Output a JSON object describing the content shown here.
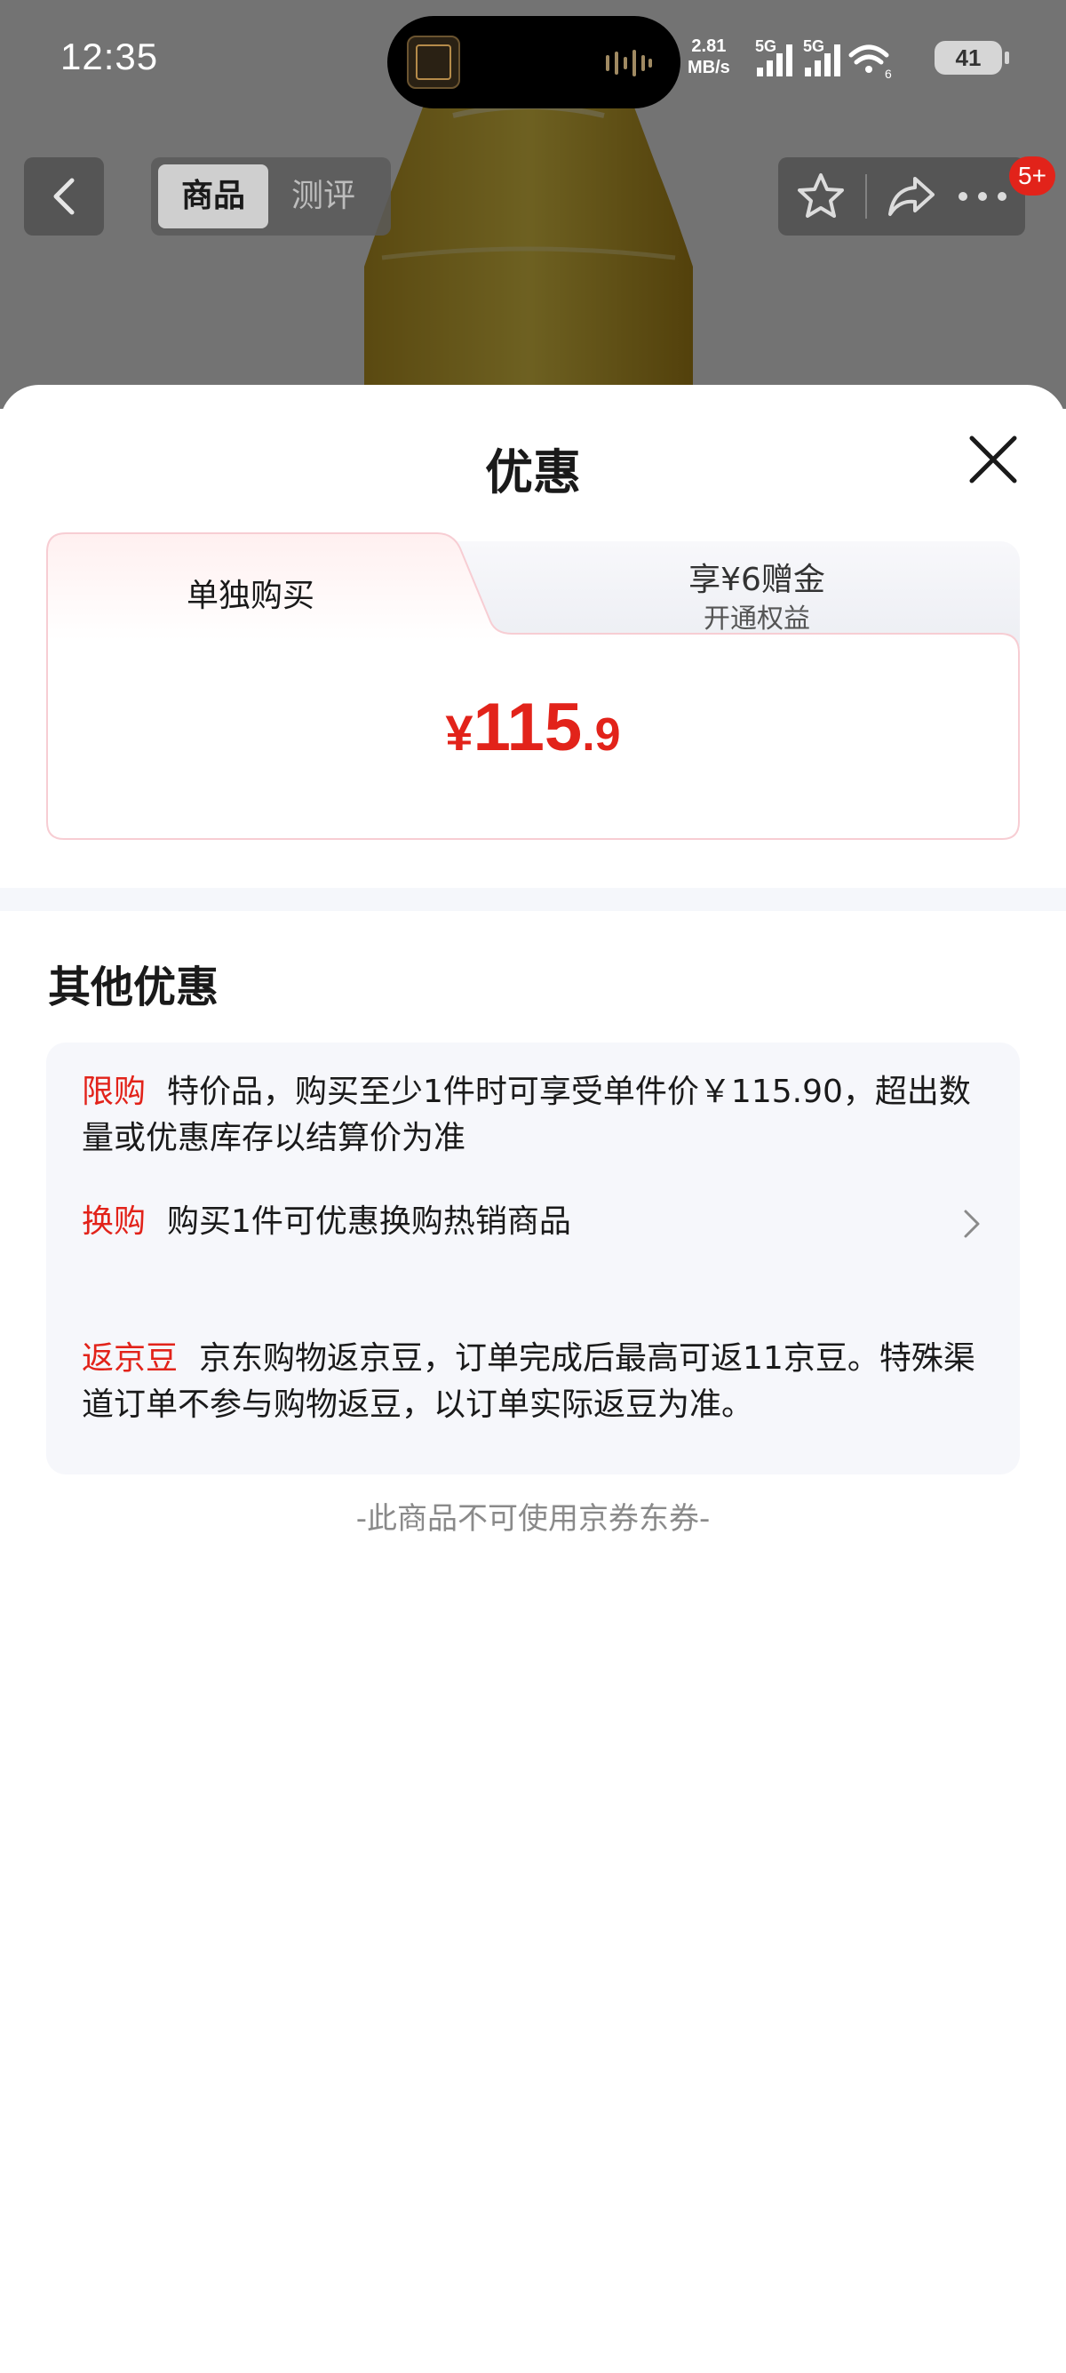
{
  "status_bar": {
    "time": "12:35",
    "net_speed_value": "2.81",
    "net_speed_unit": "MB/s",
    "signal_1_label": "5G",
    "signal_2_label": "5G",
    "wifi_label": "6",
    "battery": "41",
    "icons": [
      "cellular-signal-icon",
      "cellular-signal-icon",
      "wifi-icon",
      "battery-icon"
    ]
  },
  "nav": {
    "tabs": [
      {
        "label": "商品",
        "active": true
      },
      {
        "label": "测评",
        "active": false
      }
    ],
    "badge": "5+",
    "icons": [
      "back-icon",
      "star-icon",
      "share-icon",
      "more-icon"
    ]
  },
  "sheet": {
    "title": "优惠",
    "price_tabs": {
      "tab1_label": "单独购买",
      "tab2_line1": "享¥6赠金",
      "tab2_line2": "开通权益"
    },
    "price": {
      "currency": "¥",
      "integer": "115",
      "decimal": ".9"
    },
    "other_title": "其他优惠",
    "offers": [
      {
        "tag": "限购",
        "text": "特价品，购买至少1件时可享受单件价￥115.90，超出数量或优惠库存以结算价为准"
      },
      {
        "tag": "换购",
        "text": "购买1件可优惠换购热销商品"
      },
      {
        "tag": "返京豆",
        "text": "京东购物返京豆，订单完成后最高可返11京豆。特殊渠道订单不参与购物返豆，以订单实际返豆为准。"
      }
    ],
    "footer_note": "-此商品不可使用京券东券-"
  },
  "colors": {
    "accent_red": "#e2231a",
    "panel_bg": "#f6f7fb",
    "muted_text": "#8a8a8a"
  }
}
